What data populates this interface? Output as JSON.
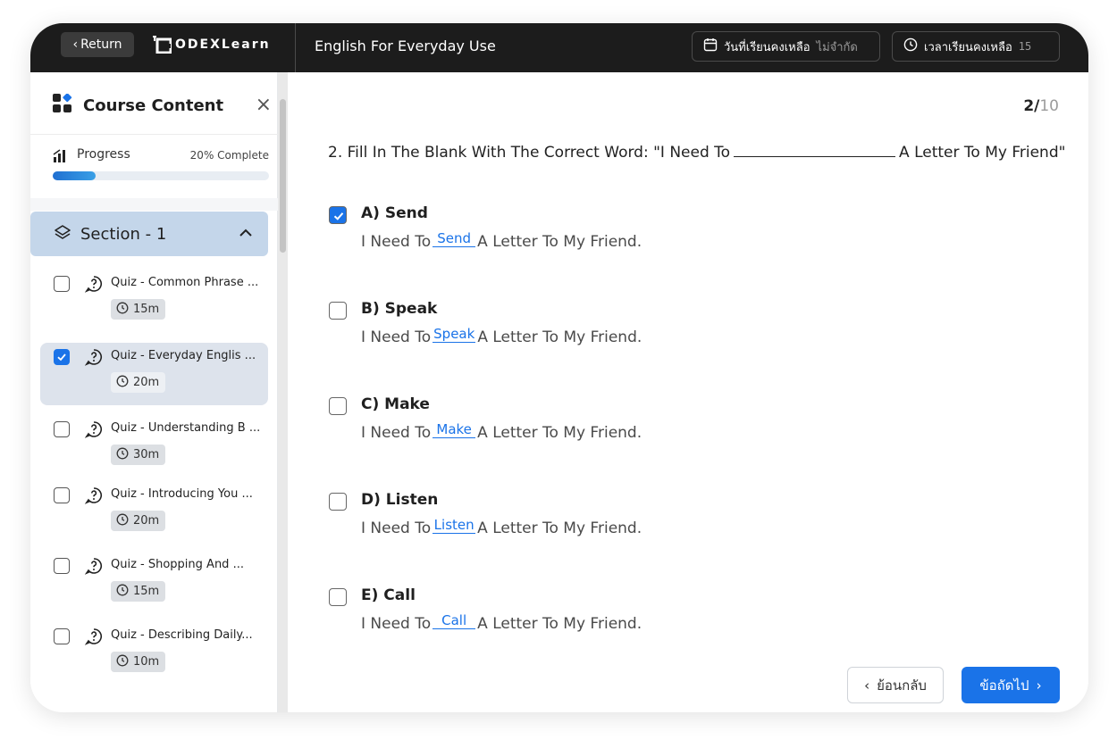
{
  "topbar": {
    "return_label": "Return",
    "logo_text": "ODEXLearn",
    "course_title": "English For Everyday Use",
    "days_left_label": "วันที่เรียนคงเหลือ",
    "days_left_value": "ไม่จำกัด",
    "time_left_label": "เวลาเรียนคงเหลือ",
    "time_left_value": "15"
  },
  "sidebar": {
    "title": "Course Content",
    "close_icon": "×",
    "progress_label": "Progress",
    "progress_text": "20% Complete",
    "progress_value": 0.2,
    "section_title": "Section - 1",
    "lessons": [
      {
        "name": "Quiz - Common Phrase ...",
        "duration": "15m",
        "checked": false
      },
      {
        "name": "Quiz - Everyday Englis ...",
        "duration": "20m",
        "checked": true
      },
      {
        "name": "Quiz - Understanding B ...",
        "duration": "30m",
        "checked": false
      },
      {
        "name": "Quiz - Introducing You ...",
        "duration": "20m",
        "checked": false
      },
      {
        "name": "Quiz - Shopping And ...",
        "duration": "15m",
        "checked": false
      },
      {
        "name": "Quiz - Describing Daily...",
        "duration": "10m",
        "checked": false
      }
    ]
  },
  "main": {
    "counter_current": "2/",
    "counter_total": "10",
    "question_prefix": "2. Fill In The Blank With The Correct Word: \"I Need To",
    "question_suffix": "A Letter To My Friend\"",
    "sentence_start": "I Need To",
    "sentence_end": "A Letter To My Friend.",
    "options": [
      {
        "label": "A)  Send",
        "word": "Send",
        "checked": true
      },
      {
        "label": "B) Speak",
        "word": "Speak",
        "checked": false
      },
      {
        "label": "C) Make",
        "word": "Make",
        "checked": false
      },
      {
        "label": "D) Listen",
        "word": "Listen",
        "checked": false
      },
      {
        "label": "E) Call",
        "word": "Call",
        "checked": false
      }
    ],
    "back_label": "ย้อนกลับ",
    "next_label": "ข้อถัดไป"
  },
  "colors": {
    "accent": "#1a73e8",
    "topbar": "#1c1c1c",
    "section_bg": "#c4d6ea",
    "active_lesson_bg": "#dde3ec"
  }
}
